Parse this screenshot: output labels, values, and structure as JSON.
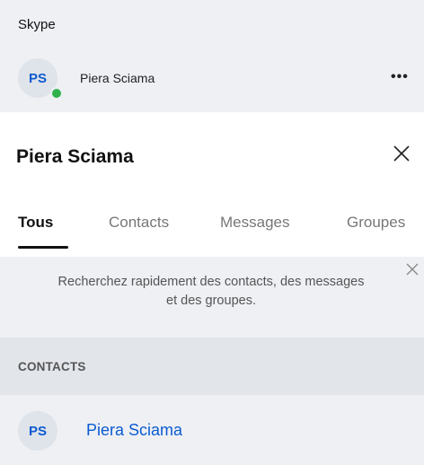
{
  "app": {
    "title": "Skype"
  },
  "user": {
    "initials": "PS",
    "name": "Piera Sciama",
    "more_label": "•••"
  },
  "search": {
    "heading": "Piera Sciama",
    "tabs": [
      {
        "label": "Tous",
        "active": true
      },
      {
        "label": "Contacts",
        "active": false
      },
      {
        "label": "Messages",
        "active": false
      },
      {
        "label": "Groupes",
        "active": false
      }
    ],
    "tip": "Recherchez rapidement des contacts, des messages et des groupes.",
    "sections": {
      "contacts": {
        "label": "CONTACTS",
        "items": [
          {
            "initials": "PS",
            "name": "Piera Sciama"
          }
        ]
      }
    }
  },
  "colors": {
    "accent": "#0c5bd0",
    "presence": "#2fb24c",
    "panel_bg": "#eef0f4",
    "section_bg": "#e2e5ea"
  }
}
